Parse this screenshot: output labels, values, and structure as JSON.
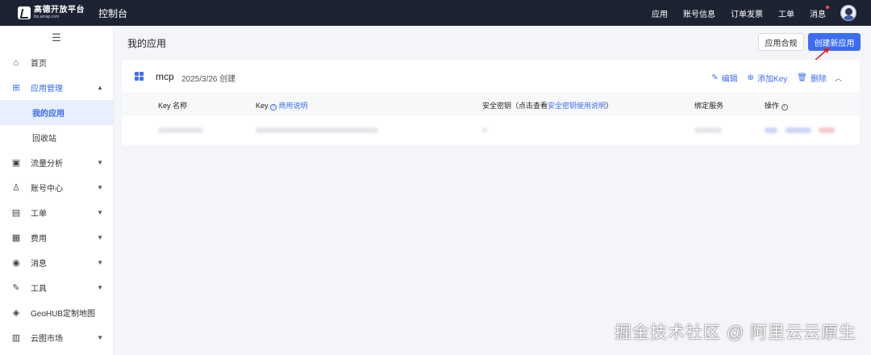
{
  "header": {
    "logo_title": "高德开放平台",
    "logo_sub": "lbs.amap.com",
    "console": "控制台",
    "nav": [
      "应用",
      "账号信息",
      "订单发票",
      "工单",
      "消息"
    ],
    "message_has_dot": true
  },
  "sidebar": {
    "items": [
      {
        "label": "首页",
        "icon": "home-icon",
        "glyph": "⌂"
      },
      {
        "label": "应用管理",
        "icon": "app-grid-icon",
        "glyph": "⊞",
        "open": true,
        "children": [
          {
            "label": "我的应用",
            "active": true
          },
          {
            "label": "回收站"
          }
        ]
      },
      {
        "label": "流量分析",
        "icon": "chart-icon",
        "glyph": "▣",
        "chevron": true
      },
      {
        "label": "账号中心",
        "icon": "user-icon",
        "glyph": "♙",
        "chevron": true
      },
      {
        "label": "工单",
        "icon": "calendar-icon",
        "glyph": "▤",
        "chevron": true
      },
      {
        "label": "费用",
        "icon": "bill-icon",
        "glyph": "▦",
        "chevron": true
      },
      {
        "label": "消息",
        "icon": "message-icon",
        "glyph": "◉",
        "chevron": true
      },
      {
        "label": "工具",
        "icon": "wrench-icon",
        "glyph": "✎",
        "chevron": true
      },
      {
        "label": "GeoHUB定制地图",
        "icon": "layers-icon",
        "glyph": "◈"
      },
      {
        "label": "云图市场",
        "icon": "store-icon",
        "glyph": "▥",
        "chevron": true
      }
    ]
  },
  "main": {
    "title": "我的应用",
    "compliance_button": "应用合规",
    "create_button": "创建新应用"
  },
  "app": {
    "name": "mcp",
    "created": "2025/3/26 创建",
    "actions": {
      "edit": "编辑",
      "add_key": "添加Key",
      "delete": "删除"
    }
  },
  "table": {
    "col_key_name": "Key 名称",
    "col_key": "Key",
    "col_key_link": "商用说明",
    "col_secret": "安全密钥（点击查看",
    "col_secret_link": "安全密钥使用说明",
    "col_secret_end": "）",
    "col_service": "绑定服务",
    "col_ops": "操作"
  },
  "colors": {
    "accent": "#3b6cf6",
    "topbar": "#1d2333"
  },
  "watermark": "掘金技术社区 @ 阿里云云原生"
}
